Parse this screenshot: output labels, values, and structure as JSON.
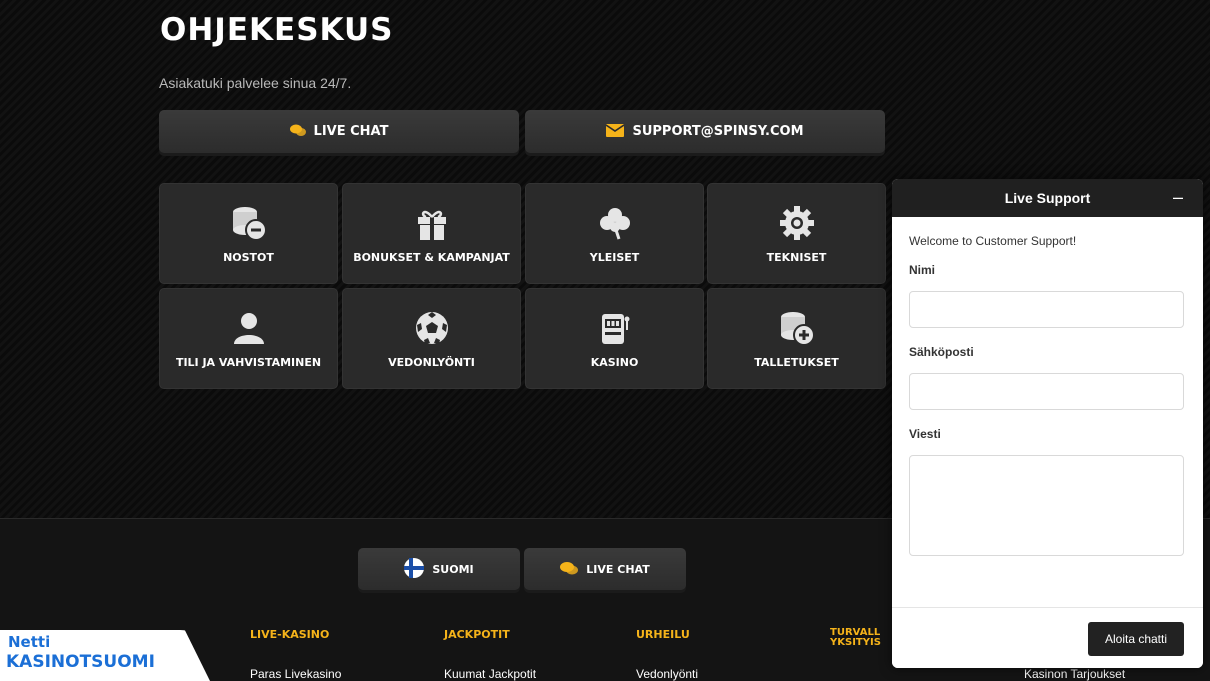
{
  "header": {
    "title": "OHJEKESKUS",
    "subtitle": "Asiakatuki palvelee sinua 24/7."
  },
  "contact": {
    "live_chat_label": "LIVE CHAT",
    "live_chat_icon": "chat-bubble-icon",
    "email_label": "SUPPORT@SPINSY.COM",
    "email_icon": "envelope-icon"
  },
  "categories": [
    {
      "label": "NOSTOT",
      "icon": "coins-minus-icon"
    },
    {
      "label": "BONUKSET & KAMPANJAT",
      "icon": "gift-icon"
    },
    {
      "label": "YLEISET",
      "icon": "clover-icon"
    },
    {
      "label": "TEKNISET",
      "icon": "gear-icon"
    },
    {
      "label": "TILI JA VAHVISTAMINEN",
      "icon": "user-icon"
    },
    {
      "label": "VEDONLYÖNTI",
      "icon": "soccer-ball-icon"
    },
    {
      "label": "KASINO",
      "icon": "slot-machine-icon"
    },
    {
      "label": "TALLETUKSET",
      "icon": "coins-plus-icon"
    }
  ],
  "footer": {
    "language_label": "SUOMI",
    "language_icon": "finland-flag-icon",
    "live_chat_label": "LIVE CHAT",
    "columns": [
      {
        "heading": "LIVE-KASINO",
        "link": "Paras Livekasino"
      },
      {
        "heading": "JACKPOTIT",
        "link": "Kuumat Jackpotit"
      },
      {
        "heading": "URHEILU",
        "link": "Vedonlyönti"
      },
      {
        "heading": "TURVALL\nYKSITYIS",
        "link": ""
      },
      {
        "heading": "",
        "link": "Kasinon Tarjoukset"
      }
    ]
  },
  "logo": {
    "line1": "Netti",
    "line2": "KASINOTSUOMI"
  },
  "chat_widget": {
    "title": "Live Support",
    "minimize_label": "–",
    "welcome": "Welcome to Customer Support!",
    "name_label": "Nimi",
    "email_label": "Sähköposti",
    "message_label": "Viesti",
    "submit_label": "Aloita chatti"
  },
  "colors": {
    "accent": "#f5b31a",
    "tile_bg": "#2a2a2a",
    "chat_header": "#202020",
    "logo_blue": "#1b6fd6"
  }
}
